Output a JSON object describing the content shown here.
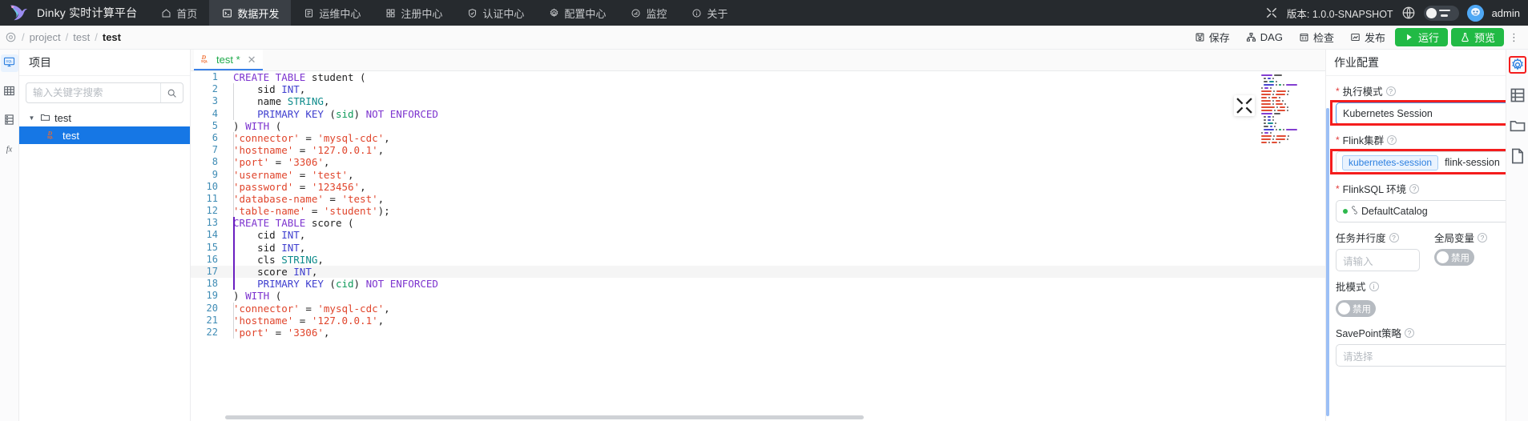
{
  "topnav": {
    "brand": "Dinky 实时计算平台",
    "items": [
      {
        "label": "首页",
        "icon": "home-icon",
        "active": false
      },
      {
        "label": "数据开发",
        "icon": "code-terminal-icon",
        "active": true
      },
      {
        "label": "运维中心",
        "icon": "ops-window-icon",
        "active": false
      },
      {
        "label": "注册中心",
        "icon": "grid-register-icon",
        "active": false
      },
      {
        "label": "认证中心",
        "icon": "shield-auth-icon",
        "active": false
      },
      {
        "label": "配置中心",
        "icon": "gear-icon",
        "active": false
      },
      {
        "label": "监控",
        "icon": "gauge-monitor-icon",
        "active": false
      },
      {
        "label": "关于",
        "icon": "info-circle-icon",
        "active": false
      }
    ],
    "shrink_icon": "collapse-arrows-icon",
    "version": "版本: 1.0.0-SNAPSHOT",
    "globe_icon": "globe-language-icon",
    "theme_icon": "theme-toggle-switch",
    "avatar_icon": "user-avatar",
    "user": "admin"
  },
  "breadcrumb": {
    "root_icon": "location-target-icon",
    "items": [
      "project",
      "test",
      "test"
    ],
    "separator": "/"
  },
  "toolbar": {
    "buttons": [
      {
        "label": "保存",
        "icon": "save-disk-icon",
        "style": "plain"
      },
      {
        "label": "DAG",
        "icon": "dag-graph-icon",
        "style": "plain"
      },
      {
        "label": "检查",
        "icon": "check-list-icon",
        "style": "plain"
      },
      {
        "label": "发布",
        "icon": "publish-chart-icon",
        "style": "plain"
      },
      {
        "label": "运行",
        "icon": "play-icon",
        "style": "green"
      },
      {
        "label": "预览",
        "icon": "preview-flask-icon",
        "style": "green"
      }
    ],
    "more": "⋮"
  },
  "rail": {
    "items": [
      {
        "icon": "sql-catalog-icon",
        "active": true
      },
      {
        "icon": "table-grid-icon",
        "active": false
      },
      {
        "icon": "database-list-icon",
        "active": false
      },
      {
        "icon": "function-fx-icon",
        "active": false
      }
    ]
  },
  "project": {
    "title": "项目",
    "search_placeholder": "输入关键字搜索",
    "search_value": "",
    "search_icon": "search-icon",
    "tree": [
      {
        "label": "test",
        "type": "folder",
        "expanded": true,
        "selected": false
      },
      {
        "label": "test",
        "type": "flinksql-file",
        "expanded": false,
        "selected": true
      }
    ]
  },
  "editor": {
    "tab": {
      "label": "test *",
      "icon": "flinksql-file-icon",
      "close": "✕"
    },
    "fullscreen_icon": "fullscreen-expand-icon",
    "current_line": 17,
    "lines": [
      {
        "n": 1,
        "tokens": [
          {
            "t": "CREATE TABLE ",
            "c": "kw"
          },
          {
            "t": "student (",
            "c": "pun"
          }
        ]
      },
      {
        "n": 2,
        "indent": true,
        "tokens": [
          {
            "t": "    sid ",
            "c": "pun"
          },
          {
            "t": "INT",
            "c": "kw2"
          },
          {
            "t": ",",
            "c": "pun"
          }
        ]
      },
      {
        "n": 3,
        "indent": true,
        "tokens": [
          {
            "t": "    name ",
            "c": "pun"
          },
          {
            "t": "STRING",
            "c": "typ"
          },
          {
            "t": ",",
            "c": "pun"
          }
        ]
      },
      {
        "n": 4,
        "indent": true,
        "tokens": [
          {
            "t": "    ",
            "c": "pun"
          },
          {
            "t": "PRIMARY KEY",
            "c": "kw2"
          },
          {
            "t": " (",
            "c": "pun"
          },
          {
            "t": "sid",
            "c": "pl"
          },
          {
            "t": ") ",
            "c": "pun"
          },
          {
            "t": "NOT ENFORCED",
            "c": "kw"
          }
        ]
      },
      {
        "n": 5,
        "tokens": [
          {
            "t": ") ",
            "c": "pun"
          },
          {
            "t": "WITH",
            "c": "kw"
          },
          {
            "t": " (",
            "c": "pun"
          }
        ]
      },
      {
        "n": 6,
        "indent": true,
        "tokens": [
          {
            "t": "'connector'",
            "c": "str"
          },
          {
            "t": " = ",
            "c": "pun"
          },
          {
            "t": "'mysql-cdc'",
            "c": "str"
          },
          {
            "t": ",",
            "c": "pun"
          }
        ]
      },
      {
        "n": 7,
        "indent": true,
        "tokens": [
          {
            "t": "'hostname'",
            "c": "str"
          },
          {
            "t": " = ",
            "c": "pun"
          },
          {
            "t": "'127.0.0.1'",
            "c": "str"
          },
          {
            "t": ",",
            "c": "pun"
          }
        ]
      },
      {
        "n": 8,
        "indent": true,
        "tokens": [
          {
            "t": "'port'",
            "c": "str"
          },
          {
            "t": " = ",
            "c": "pun"
          },
          {
            "t": "'3306'",
            "c": "str"
          },
          {
            "t": ",",
            "c": "pun"
          }
        ]
      },
      {
        "n": 9,
        "indent": true,
        "tokens": [
          {
            "t": "'username'",
            "c": "str"
          },
          {
            "t": " = ",
            "c": "pun"
          },
          {
            "t": "'test'",
            "c": "str"
          },
          {
            "t": ",",
            "c": "pun"
          }
        ]
      },
      {
        "n": 10,
        "indent": true,
        "tokens": [
          {
            "t": "'password'",
            "c": "str"
          },
          {
            "t": " = ",
            "c": "pun"
          },
          {
            "t": "'123456'",
            "c": "str"
          },
          {
            "t": ",",
            "c": "pun"
          }
        ]
      },
      {
        "n": 11,
        "indent": true,
        "tokens": [
          {
            "t": "'database-name'",
            "c": "str"
          },
          {
            "t": " = ",
            "c": "pun"
          },
          {
            "t": "'test'",
            "c": "str"
          },
          {
            "t": ",",
            "c": "pun"
          }
        ]
      },
      {
        "n": 12,
        "indent": true,
        "tokens": [
          {
            "t": "'table-name'",
            "c": "str"
          },
          {
            "t": " = ",
            "c": "pun"
          },
          {
            "t": "'student'",
            "c": "str"
          },
          {
            "t": ");",
            "c": "pun"
          }
        ]
      },
      {
        "n": 13,
        "block": true,
        "tokens": [
          {
            "t": "CREATE TABLE ",
            "c": "kw"
          },
          {
            "t": "score (",
            "c": "pun"
          }
        ]
      },
      {
        "n": 14,
        "block": true,
        "tokens": [
          {
            "t": "    cid ",
            "c": "pun"
          },
          {
            "t": "INT",
            "c": "kw2"
          },
          {
            "t": ",",
            "c": "pun"
          }
        ]
      },
      {
        "n": 15,
        "block": true,
        "tokens": [
          {
            "t": "    sid ",
            "c": "pun"
          },
          {
            "t": "INT",
            "c": "kw2"
          },
          {
            "t": ",",
            "c": "pun"
          }
        ]
      },
      {
        "n": 16,
        "block": true,
        "tokens": [
          {
            "t": "    cls ",
            "c": "pun"
          },
          {
            "t": "STRING",
            "c": "typ"
          },
          {
            "t": ",",
            "c": "pun"
          }
        ]
      },
      {
        "n": 17,
        "block": true,
        "tokens": [
          {
            "t": "    score ",
            "c": "pun"
          },
          {
            "t": "INT",
            "c": "kw2"
          },
          {
            "t": ",",
            "c": "pun"
          }
        ]
      },
      {
        "n": 18,
        "block": true,
        "tokens": [
          {
            "t": "    ",
            "c": "pun"
          },
          {
            "t": "PRIMARY KEY",
            "c": "kw2"
          },
          {
            "t": " (",
            "c": "pun"
          },
          {
            "t": "cid",
            "c": "pl"
          },
          {
            "t": ") ",
            "c": "pun"
          },
          {
            "t": "NOT ENFORCED",
            "c": "kw"
          }
        ]
      },
      {
        "n": 19,
        "tokens": [
          {
            "t": ") ",
            "c": "pun"
          },
          {
            "t": "WITH",
            "c": "kw"
          },
          {
            "t": " (",
            "c": "pun"
          }
        ]
      },
      {
        "n": 20,
        "indent": true,
        "tokens": [
          {
            "t": "'connector'",
            "c": "str"
          },
          {
            "t": " = ",
            "c": "pun"
          },
          {
            "t": "'mysql-cdc'",
            "c": "str"
          },
          {
            "t": ",",
            "c": "pun"
          }
        ]
      },
      {
        "n": 21,
        "indent": true,
        "tokens": [
          {
            "t": "'hostname'",
            "c": "str"
          },
          {
            "t": " = ",
            "c": "pun"
          },
          {
            "t": "'127.0.0.1'",
            "c": "str"
          },
          {
            "t": ",",
            "c": "pun"
          }
        ]
      },
      {
        "n": 22,
        "indent": true,
        "tokens": [
          {
            "t": "'port'",
            "c": "str"
          },
          {
            "t": " = ",
            "c": "pun"
          },
          {
            "t": "'3306'",
            "c": "str"
          },
          {
            "t": ",",
            "c": "pun"
          }
        ]
      }
    ]
  },
  "config": {
    "title": "作业配置",
    "minimize_icon": "minimize-icon",
    "exec_mode": {
      "label": "执行模式",
      "required": true,
      "value": "Kubernetes Session",
      "highlighted": true
    },
    "flink_cluster": {
      "label": "Flink集群",
      "required": true,
      "tag": "kubernetes-session",
      "value": "flink-session",
      "highlighted": true
    },
    "flinksql_env": {
      "label": "FlinkSQL 环境",
      "required": true,
      "value": "DefaultCatalog"
    },
    "parallelism": {
      "label": "任务并行度",
      "required": false,
      "placeholder": "请输入",
      "value": ""
    },
    "global_var": {
      "label": "全局变量",
      "required": false,
      "toggle_label": "禁用",
      "enabled": false
    },
    "batch_mode": {
      "label": "批模式",
      "required": false,
      "toggle_label": "禁用",
      "enabled": false
    },
    "savepoint": {
      "label": "SavePoint策略",
      "required": false,
      "placeholder": "请选择",
      "value": ""
    },
    "side_icons": [
      {
        "icon": "gear-icon",
        "active": true
      },
      {
        "icon": "save-config-icon",
        "active": false
      },
      {
        "icon": "folder-icon",
        "active": false
      },
      {
        "icon": "document-icon",
        "active": false
      }
    ]
  },
  "colors": {
    "nav_bg": "#262a2e",
    "nav_active": "#3a3f45",
    "accent_blue": "#1677e5",
    "green": "#21ba45",
    "annotation_red": "#f41d1d",
    "tab_green": "#1faa4b"
  }
}
